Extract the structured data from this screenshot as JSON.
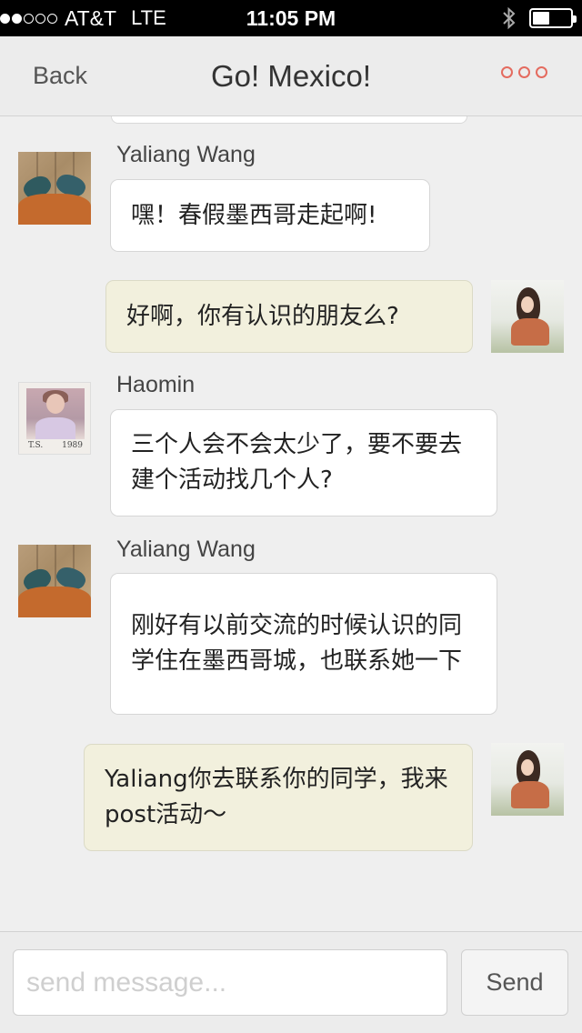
{
  "status_bar": {
    "carrier": "AT&T",
    "network": "LTE",
    "time": "11:05 PM",
    "signal_strength": 1,
    "signal_max": 5,
    "battery_level": 0.45,
    "icons": [
      "bluetooth-icon",
      "battery-icon"
    ]
  },
  "nav": {
    "back_label": "Back",
    "title": "Go! Mexico!",
    "more_icon": "more-options-icon",
    "accent_color": "#e46b5f"
  },
  "messages": [
    {
      "sender": "Yaliang Wang",
      "direction": "incoming",
      "avatar": "sneakers-avatar",
      "text": "嘿！春假墨西哥走起啊!"
    },
    {
      "sender": "",
      "direction": "outgoing",
      "avatar": "girl-avatar",
      "text": "好啊，你有认识的朋友么?"
    },
    {
      "sender": "Haomin",
      "direction": "incoming",
      "avatar": "album-1989-avatar",
      "text": "三个人会不会太少了，要不要去建个活动找几个人?"
    },
    {
      "sender": "Yaliang Wang",
      "direction": "incoming",
      "avatar": "sneakers-avatar",
      "text": "刚好有以前交流的时候认识的同学住在墨西哥城，也联系她一下"
    },
    {
      "sender": "",
      "direction": "outgoing",
      "avatar": "girl-avatar",
      "text": "Yaliang你去联系你的同学，我来post活动～"
    }
  ],
  "album_caption": {
    "left": "T.S.",
    "right": "1989"
  },
  "composer": {
    "placeholder": "send message...",
    "value": "",
    "send_label": "Send"
  },
  "colors": {
    "outgoing_bubble": "#f2f0dd",
    "incoming_bubble": "#ffffff",
    "background": "#efefef"
  }
}
